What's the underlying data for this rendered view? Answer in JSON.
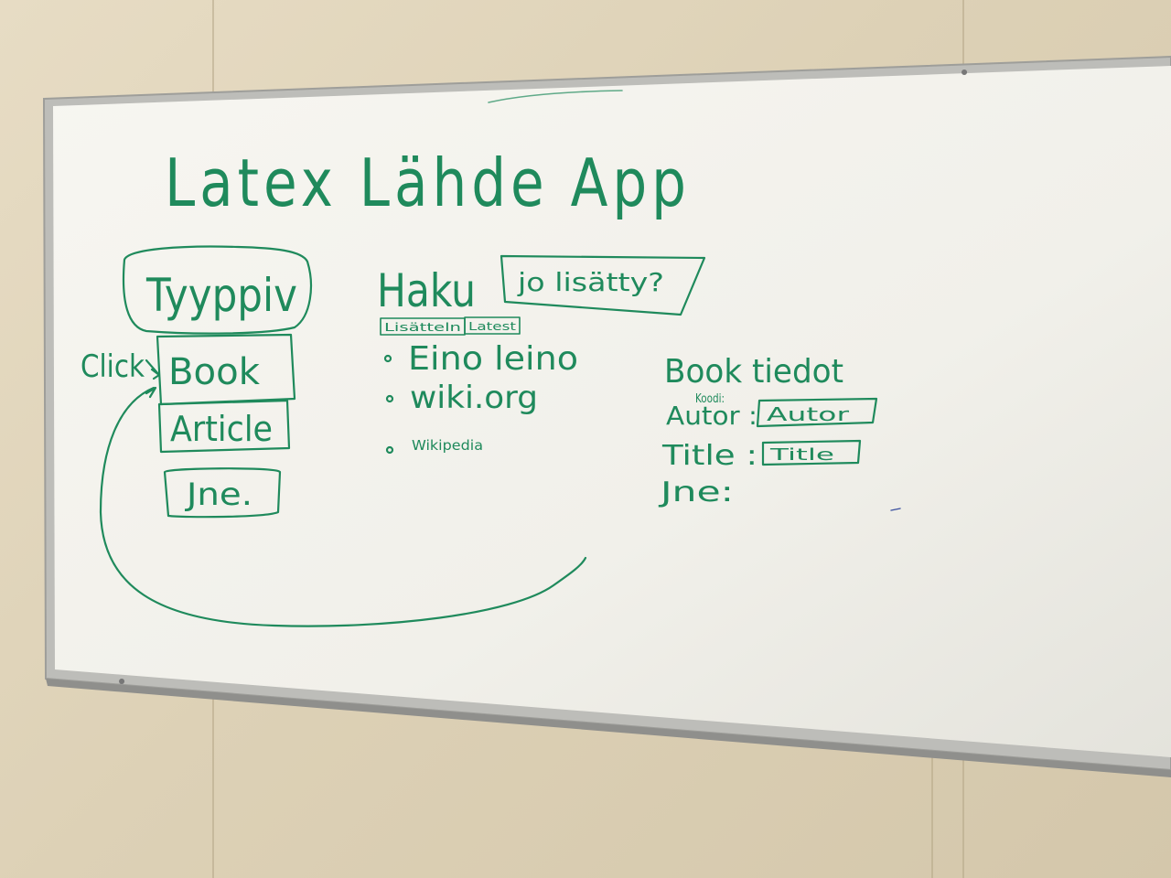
{
  "whiteboard": {
    "title": "Latex Lähde App",
    "left_column": {
      "header": "Tyyppiv",
      "items": [
        "Book",
        "Article",
        "Jne."
      ],
      "click_label": "Click"
    },
    "middle_column": {
      "search_label": "Haku",
      "question_box": "jo lisätty?",
      "sort_buttons": [
        "Lisätteln",
        "Latest"
      ],
      "bullets": [
        "Eino leino",
        "wiki.org",
        "Wikipedia"
      ]
    },
    "right_column": {
      "heading": "Book tiedot",
      "small_label": "Koodi:",
      "fields": [
        {
          "label": "Autor :",
          "value": "Autor"
        },
        {
          "label": "Title :",
          "value": "Title"
        },
        {
          "label": "Jne:",
          "value": ""
        }
      ]
    }
  },
  "colors": {
    "ink": "#1f8a5c",
    "board": "#f4f3ee",
    "frame": "#b9b9b6",
    "wall": "#ddd1b6"
  }
}
